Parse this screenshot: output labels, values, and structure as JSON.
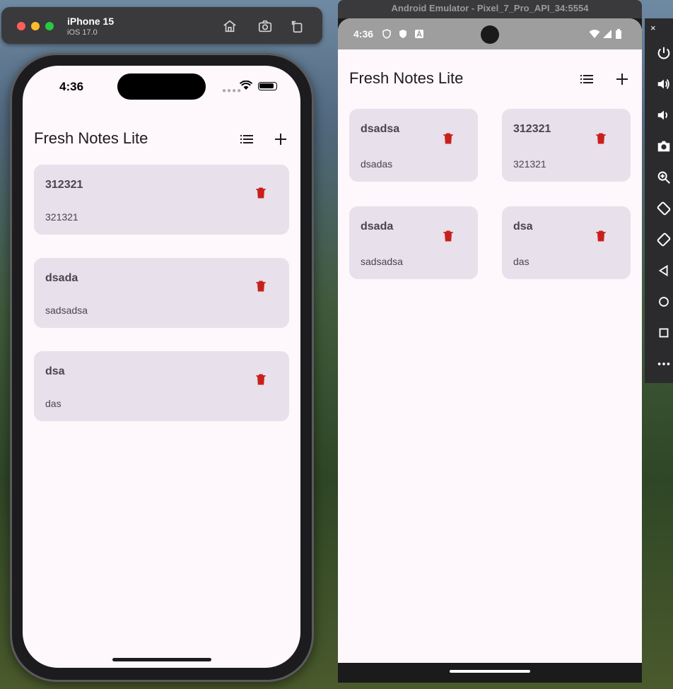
{
  "ios_simulator": {
    "device_name": "iPhone 15",
    "os_version": "iOS 17.0",
    "toolbar_icons": [
      "home-icon",
      "screenshot-icon",
      "rotate-icon"
    ],
    "status_time": "4:36",
    "app_title": "Fresh Notes Lite",
    "notes": [
      {
        "title": "312321",
        "body": "321321"
      },
      {
        "title": "dsada",
        "body": "sadsadsa"
      },
      {
        "title": "dsa",
        "body": "das"
      }
    ]
  },
  "android_emulator": {
    "window_title": "Android Emulator - Pixel_7_Pro_API_34:5554",
    "status_time": "4:36",
    "app_title": "Fresh Notes Lite",
    "notes": [
      {
        "title": "dsadsa",
        "body": "dsadas"
      },
      {
        "title": "312321",
        "body": "321321"
      },
      {
        "title": "dsada",
        "body": "sadsadsa"
      },
      {
        "title": "dsa",
        "body": "das"
      }
    ],
    "side_controls": [
      "close",
      "power-icon",
      "volume-up-icon",
      "volume-down-icon",
      "camera-icon",
      "zoom-icon",
      "rotate-left-icon",
      "rotate-right-icon",
      "back-icon",
      "home-icon",
      "overview-icon",
      "more-icon"
    ],
    "close_label": "×"
  },
  "colors": {
    "card_bg": "#e8e0ea",
    "screen_bg": "#fef7fb",
    "trash_red": "#c8201c",
    "text_primary": "#1d1b20",
    "text_secondary": "#49454f"
  }
}
